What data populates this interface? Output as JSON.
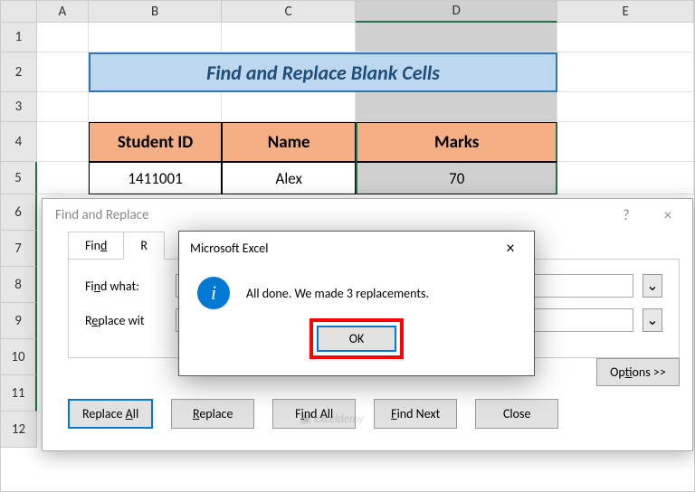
{
  "columns": {
    "A": "A",
    "B": "B",
    "C": "C",
    "D": "D",
    "E": "E"
  },
  "rows": [
    "1",
    "2",
    "3",
    "4",
    "5",
    "6",
    "7",
    "8",
    "9",
    "10",
    "11",
    "12"
  ],
  "sheet": {
    "title": "Find and Replace Blank Cells",
    "headers": {
      "id": "Student ID",
      "name": "Name",
      "marks": "Marks"
    },
    "row1": {
      "id": "1411001",
      "name": "Alex",
      "marks": "70"
    }
  },
  "findReplace": {
    "title": "Find and Replace",
    "help": "?",
    "close": "×",
    "tabs": {
      "find": "Find",
      "replace": "R"
    },
    "labels": {
      "findWhat": "Find what:",
      "replaceWith": "Replace wit"
    },
    "options": "Options >>",
    "buttons": {
      "replaceAll": {
        "pre": "Replace ",
        "u": "A",
        "post": "ll"
      },
      "replace": {
        "u": "R",
        "post": "eplace"
      },
      "findAll": {
        "pre": "F",
        "u": "i",
        "post": "nd All"
      },
      "findNext": {
        "u": "F",
        "post": "ind Next"
      },
      "close": "Close"
    }
  },
  "msg": {
    "title": "Microsoft Excel",
    "close": "×",
    "icon": "i",
    "text": "All done. We made 3 replacements.",
    "ok": "OK"
  },
  "watermark": "exceldemy"
}
